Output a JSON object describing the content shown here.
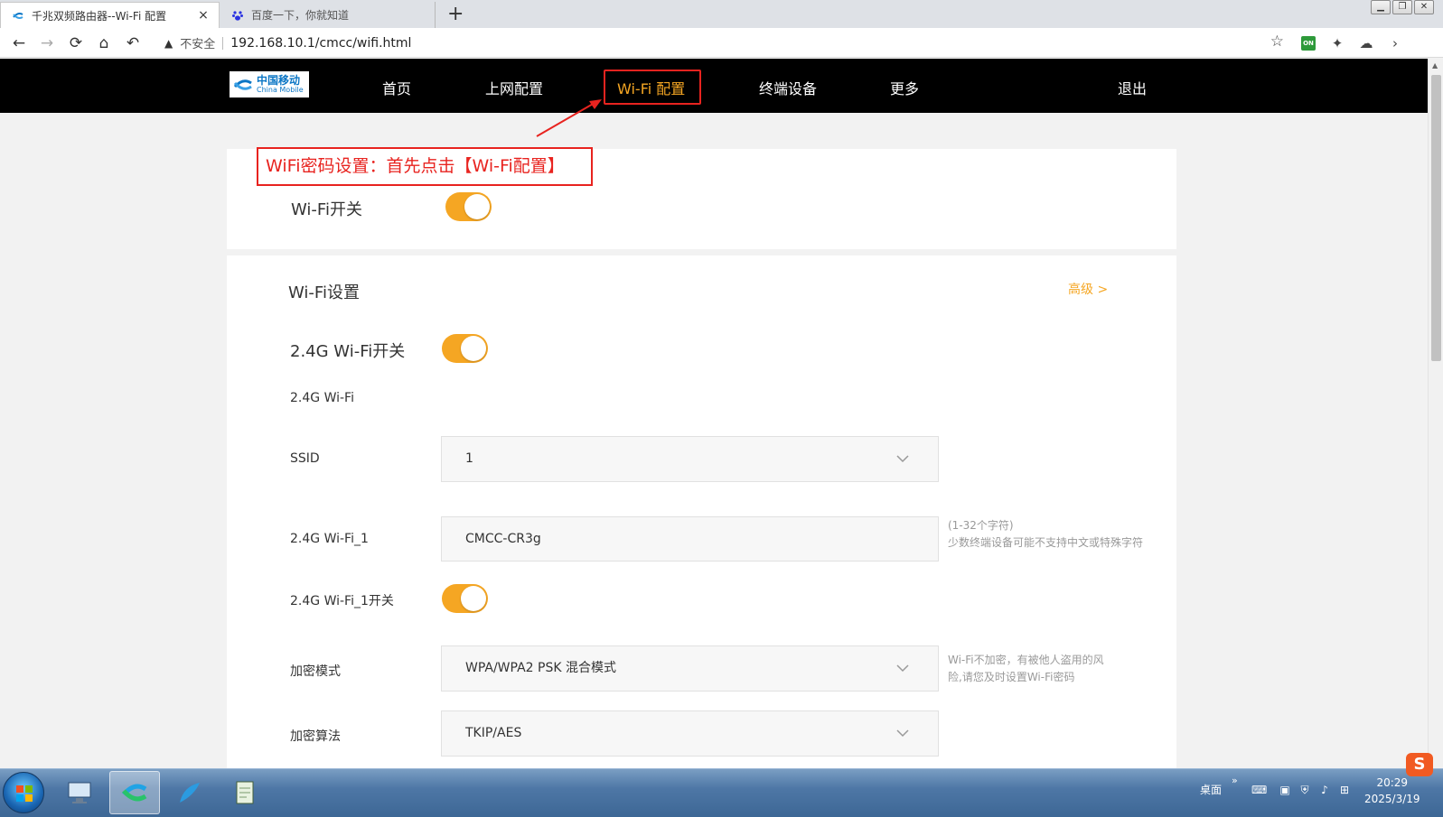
{
  "browser": {
    "tabs": [
      {
        "title": "千兆双频路由器--Wi-Fi 配置",
        "close": "×",
        "active": true
      },
      {
        "title": "百度一下，你就知道",
        "active": false
      }
    ],
    "new_tab": "+",
    "security_label": "不安全",
    "url": "192.168.10.1/cmcc/wifi.html",
    "extension_on_label": "ON"
  },
  "site": {
    "logo": {
      "cn": "中国移动",
      "en": "China Mobile"
    },
    "nav": [
      "首页",
      "上网配置",
      "Wi-Fi 配置",
      "终端设备",
      "更多"
    ],
    "active_nav": "Wi-Fi 配置",
    "logout": "退出"
  },
  "annotation": {
    "callout_text": "WiFi密码设置：首先点击【Wi-Fi配置】",
    "color": "#e8231f"
  },
  "wifi_master": {
    "label": "Wi-Fi开关",
    "on": true
  },
  "wifi_settings": {
    "title": "Wi-Fi设置",
    "advanced_link": "高级 >",
    "band_switch": {
      "label": "2.4G Wi-Fi开关",
      "on": true
    },
    "band_heading": "2.4G Wi-Fi",
    "ssid": {
      "label": "SSID",
      "value": "1"
    },
    "ssid_name": {
      "label": "2.4G Wi-Fi_1",
      "value": "CMCC-CR3g",
      "hint_line1": "(1-32个字符)",
      "hint_line2": "少数终端设备可能不支持中文或特殊字符"
    },
    "ssid_switch": {
      "label": "2.4G Wi-Fi_1开关",
      "on": true
    },
    "encryption_mode": {
      "label": "加密模式",
      "value": "WPA/WPA2 PSK 混合模式",
      "hint_line1": "Wi-Fi不加密，有被他人盗用的风",
      "hint_line2": "险,请您及时设置Wi-Fi密码"
    },
    "encryption_algorithm": {
      "label": "加密算法",
      "value": "TKIP/AES"
    }
  },
  "colors": {
    "accent": "#f5a623",
    "nav_bg": "#000000",
    "page_bg": "#f2f2f2"
  },
  "taskbar": {
    "desktop_label": "桌面",
    "time": "20:29",
    "date": "2025/3/19",
    "ime": "S"
  }
}
